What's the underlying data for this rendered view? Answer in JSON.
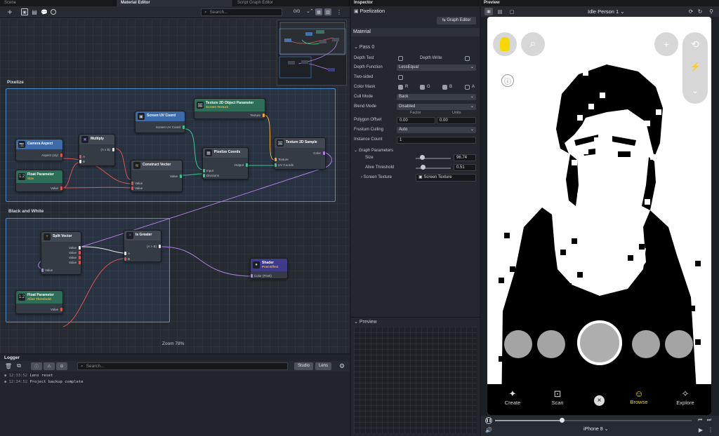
{
  "tabs": {
    "scene": "Scene",
    "material": "Material Editor",
    "script": "Script Graph Editor",
    "inspector": "Inspector",
    "preview": "Preview"
  },
  "toolbar": {
    "search_placeholder": "Search...",
    "counter": "0/0"
  },
  "groups": {
    "pixelize": "Pixelize",
    "bw": "Black and White"
  },
  "nodes": {
    "camera": {
      "title": "Camera Aspect",
      "out": "Aspect (x/y)"
    },
    "float1": {
      "title": "Float Parameter",
      "sub": "Size",
      "out": "Value"
    },
    "multiply": {
      "title": "Multiply",
      "in_a": "A",
      "in_b": "B",
      "out": "(A x B)"
    },
    "screenuv": {
      "title": "Screen UV Coord",
      "out": "Screen UV Coord"
    },
    "construct": {
      "title": "Construct Vector",
      "in1": "Value",
      "in2": "Value",
      "out": "Value"
    },
    "tex2dobj": {
      "title": "Texture 2D Object Parameter",
      "sub": "Screen Texture",
      "out": "Texture"
    },
    "pixcoords": {
      "title": "Pixelize Coords",
      "in1": "Input",
      "in2": "Divisions",
      "out": "Output"
    },
    "tex2dsample": {
      "title": "Texture 2D Sample",
      "in1": "Texture",
      "in2": "UV Coords",
      "out": "Color"
    },
    "split": {
      "title": "Split Vector",
      "in": "Value",
      "out1": "Value",
      "out2": "Value",
      "out3": "Value",
      "out4": "Value"
    },
    "isgreater": {
      "title": "Is Greater",
      "in_a": "A",
      "in_b": "B",
      "out": "(A > B)"
    },
    "shader": {
      "title": "Shader",
      "sub": "Post Effect",
      "in": "Color (Pixel)"
    },
    "float2": {
      "title": "Float Parameter",
      "sub": "Alive Threshold",
      "out": "Value"
    }
  },
  "zoom": "Zoom 78%",
  "logger": {
    "title": "Logger",
    "search_placeholder": "Search...",
    "studio": "Studio",
    "lens": "Lens",
    "entries": [
      {
        "time": "12:33:52",
        "text": "Lens reset"
      },
      {
        "time": "12:34:52",
        "text": "Project backup complete"
      }
    ]
  },
  "inspector": {
    "name": "Pixelization",
    "graph_editor": "Graph Editor",
    "material": "Material",
    "pass": "Pass 0",
    "depth_test": "Depth Test",
    "depth_write": "Depth Write",
    "depth_function": "Depth Function",
    "depth_function_value": "LessEqual",
    "two_sided": "Two-sided",
    "color_mask": "Color Mask",
    "r": "R",
    "g": "G",
    "b": "B",
    "a": "A",
    "cull_mode": "Cull Mode",
    "cull_mode_value": "Back",
    "blend_mode": "Blend Mode",
    "blend_mode_value": "Disabled",
    "factor": "Factor",
    "units": "Units",
    "polygon_offset": "Polygon Offset",
    "factor_value": "0.00",
    "units_value": "0.00",
    "frustum_culling": "Frustum Culling",
    "frustum_value": "Auto",
    "instance_count": "Instance Count",
    "instance_value": "1",
    "graph_parameters": "Graph Parameters",
    "size": "Size",
    "size_value": "96.74",
    "size_level": 0.18,
    "alive_threshold": "Alive Threshold",
    "alive_value": "0.51",
    "alive_level": 0.21,
    "screen_texture": "Screen Texture",
    "screen_texture_value": "Screen Texture",
    "preview": "Preview"
  },
  "preview": {
    "person": "Idle Person 1",
    "device": "iPhone 8",
    "progress": 0.34,
    "nav": [
      "Create",
      "Scan",
      "Browse",
      "Explore"
    ],
    "accent": "#f5d800"
  }
}
